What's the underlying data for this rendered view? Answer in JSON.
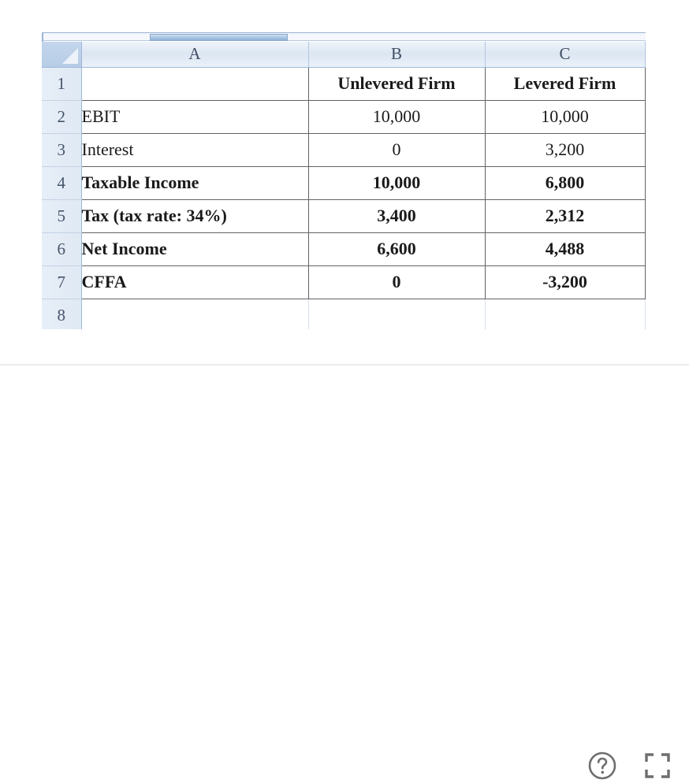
{
  "viewer": {
    "help_icon": "question-circle-icon",
    "fullscreen_icon": "fullscreen-expand-icon"
  },
  "spreadsheet": {
    "select_all_label": "",
    "column_headers": [
      "A",
      "B",
      "C"
    ],
    "row_headers": [
      "1",
      "2",
      "3",
      "4",
      "5",
      "6",
      "7",
      "8"
    ],
    "rows": [
      {
        "num": "1",
        "a": "",
        "b": "Unlevered Firm",
        "c": "Levered Firm",
        "bold": true
      },
      {
        "num": "2",
        "a": "EBIT",
        "b": "10,000",
        "c": "10,000",
        "bold": false
      },
      {
        "num": "3",
        "a": "Interest",
        "b": "0",
        "c": "3,200",
        "bold": false
      },
      {
        "num": "4",
        "a": "Taxable Income",
        "b": "10,000",
        "c": "6,800",
        "bold": true
      },
      {
        "num": "5",
        "a": "Tax (tax rate: 34%)",
        "b": "3,400",
        "c": "2,312",
        "bold": true
      },
      {
        "num": "6",
        "a": "Net Income",
        "b": "6,600",
        "c": "4,488",
        "bold": true
      },
      {
        "num": "7",
        "a": "CFFA",
        "b": "0",
        "c": "-3,200",
        "bold": true
      },
      {
        "num": "8",
        "a": "",
        "b": "",
        "c": "",
        "bold": false
      }
    ]
  },
  "colors": {
    "header_blue": "#b7cce6",
    "grid_border": "#636363",
    "icon_gray": "#6e6e6e",
    "divider": "#ececec"
  }
}
